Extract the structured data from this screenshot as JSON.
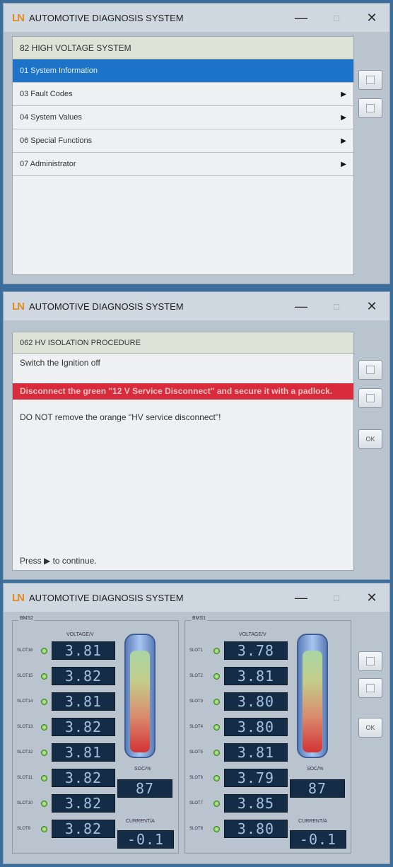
{
  "app_title": "AUTOMOTIVE DIAGNOSIS SYSTEM",
  "logo_text": "LN",
  "window_controls": {
    "minimize": "—",
    "maximize": "□",
    "close": "✕"
  },
  "menu": {
    "header": "82 HIGH VOLTAGE SYSTEM",
    "items": [
      {
        "label": "01 System Information",
        "active": true,
        "arrow": ""
      },
      {
        "label": "03 Fault Codes",
        "active": false,
        "arrow": "▶"
      },
      {
        "label": "04 System Values",
        "active": false,
        "arrow": "▶"
      },
      {
        "label": "06 Special Functions",
        "active": false,
        "arrow": "▶"
      },
      {
        "label": "07 Administrator",
        "active": false,
        "arrow": "▶"
      }
    ]
  },
  "procedure": {
    "header": "062 HV ISOLATION PROCEDURE",
    "step1": "Switch the Ignition off",
    "warning": "Disconnect the green \"12 V Service Disconnect\" and secure it with a padlock.",
    "note": "DO NOT remove the orange \"HV service disconnect\"!",
    "footer": "Press ▶ to continue.",
    "ok_label": "OK"
  },
  "bms": {
    "ok_label": "OK",
    "voltage_header": "VOLTAGE/V",
    "soc_label": "SOC/%",
    "current_label": "CURRENT/A",
    "colors": {
      "lcd_bg": "#142c46",
      "led": "#57b02e",
      "accent": "#1d73c7",
      "warning": "#d82b3b"
    },
    "left": {
      "title": "BMS2",
      "slots": [
        {
          "label": "SLOT16",
          "value": "3.81"
        },
        {
          "label": "SLOT15",
          "value": "3.82"
        },
        {
          "label": "SLOT14",
          "value": "3.81"
        },
        {
          "label": "SLOT13",
          "value": "3.82"
        },
        {
          "label": "SLOT12",
          "value": "3.81"
        },
        {
          "label": "SLOT11",
          "value": "3.82"
        },
        {
          "label": "SLOT10",
          "value": "3.82"
        },
        {
          "label": "SLOT9",
          "value": "3.82"
        }
      ],
      "soc": "87",
      "current": "-0.1"
    },
    "right": {
      "title": "BMS1",
      "slots": [
        {
          "label": "SLOT1",
          "value": "3.78"
        },
        {
          "label": "SLOT2",
          "value": "3.81"
        },
        {
          "label": "SLOT3",
          "value": "3.80"
        },
        {
          "label": "SLOT4",
          "value": "3.80"
        },
        {
          "label": "SLOT5",
          "value": "3.81"
        },
        {
          "label": "SLOT6",
          "value": "3.79"
        },
        {
          "label": "SLOT7",
          "value": "3.85"
        },
        {
          "label": "SLOT8",
          "value": "3.80"
        }
      ],
      "soc": "87",
      "current": "-0.1"
    }
  }
}
